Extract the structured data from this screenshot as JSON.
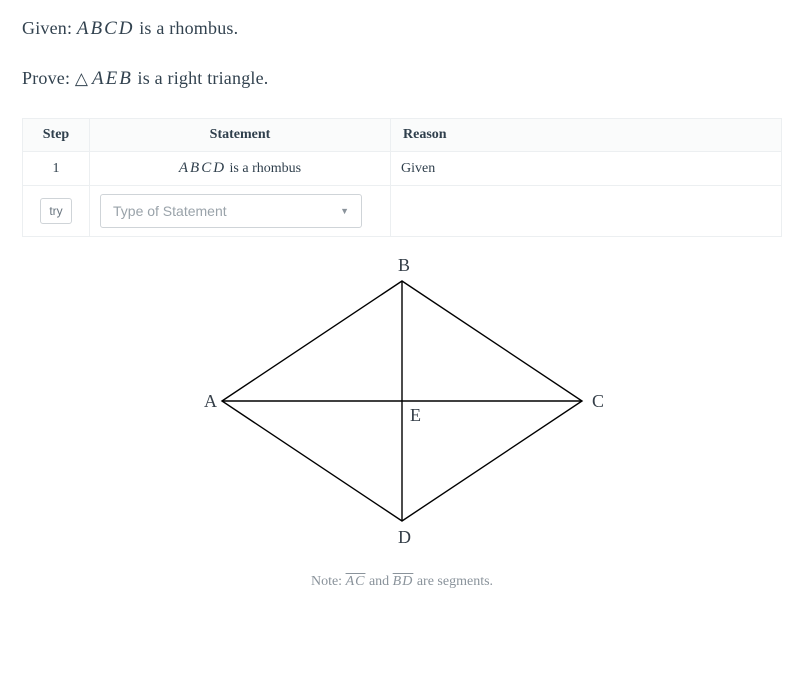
{
  "given_label": "Given:",
  "given_text_math": "ABCD",
  "given_text_rest": " is a rhombus.",
  "prove_label": "Prove:",
  "prove_text_math": "AEB",
  "prove_text_rest": " is a right triangle.",
  "table": {
    "headers": {
      "step": "Step",
      "statement": "Statement",
      "reason": "Reason"
    },
    "row1": {
      "step": "1",
      "stmt_math": "ABCD",
      "stmt_rest": " is a rhombus",
      "reason": "Given"
    },
    "row2": {
      "try": "try",
      "placeholder": "Type of Statement"
    }
  },
  "diagram": {
    "labels": {
      "A": "A",
      "B": "B",
      "C": "C",
      "D": "D",
      "E": "E"
    }
  },
  "note": {
    "prefix": "Note: ",
    "seg1": "AC",
    "mid": " and ",
    "seg2": "BD",
    "suffix": " are segments."
  }
}
